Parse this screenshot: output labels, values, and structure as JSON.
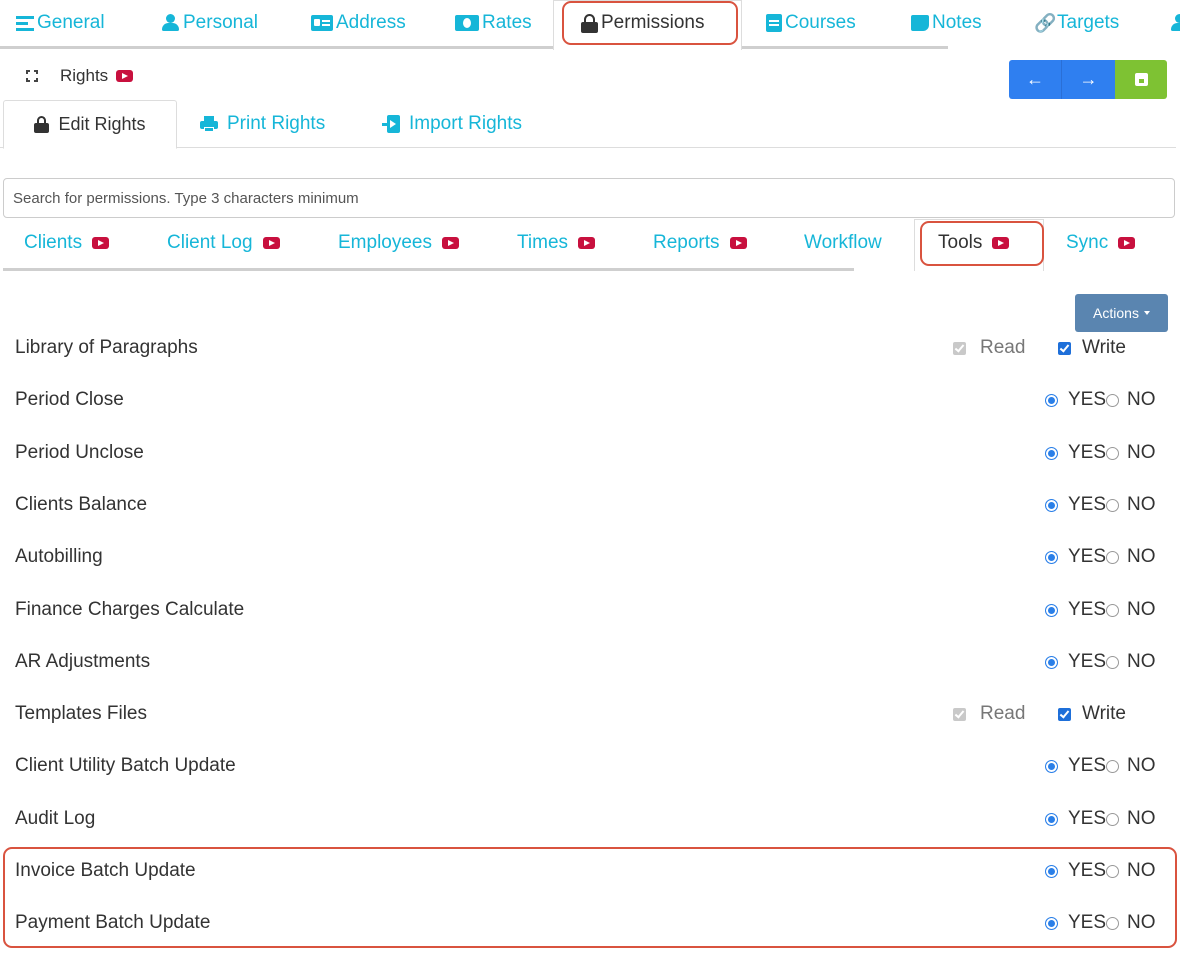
{
  "top_tabs": [
    {
      "label": "General",
      "icon": "lines-icon"
    },
    {
      "label": "Personal",
      "icon": "person-icon"
    },
    {
      "label": "Address",
      "icon": "address-card-icon"
    },
    {
      "label": "Rates",
      "icon": "money-icon"
    },
    {
      "label": "Permissions",
      "icon": "lock-icon",
      "active": true
    },
    {
      "label": "Courses",
      "icon": "book-icon"
    },
    {
      "label": "Notes",
      "icon": "note-icon"
    },
    {
      "label": "Targets",
      "icon": "link-icon"
    }
  ],
  "rights": {
    "title": "Rights",
    "tabs": [
      {
        "label": "Edit Rights",
        "icon": "lock-icon",
        "active": true
      },
      {
        "label": "Print Rights",
        "icon": "print-icon"
      },
      {
        "label": "Import Rights",
        "icon": "import-icon"
      }
    ]
  },
  "toolbar": {
    "back_symbol": "←",
    "forward_symbol": "→"
  },
  "search": {
    "placeholder": "Search for permissions. Type 3 characters minimum",
    "value": ""
  },
  "categories": [
    {
      "label": "Clients",
      "video": true
    },
    {
      "label": "Client Log",
      "video": true
    },
    {
      "label": "Employees",
      "video": true
    },
    {
      "label": "Times",
      "video": true
    },
    {
      "label": "Reports",
      "video": true
    },
    {
      "label": "Workflow",
      "video": false
    },
    {
      "label": "Tools",
      "video": true,
      "active": true
    },
    {
      "label": "Sync",
      "video": true
    }
  ],
  "actions": {
    "label": "Actions"
  },
  "options": {
    "read": "Read",
    "write": "Write",
    "yes": "YES",
    "no": "NO"
  },
  "permissions": [
    {
      "label": "Library of Paragraphs",
      "type": "read-write",
      "read": true,
      "write": true
    },
    {
      "label": "Period Close",
      "type": "yes-no",
      "value": "yes"
    },
    {
      "label": "Period Unclose",
      "type": "yes-no",
      "value": "yes"
    },
    {
      "label": "Clients Balance",
      "type": "yes-no",
      "value": "yes"
    },
    {
      "label": "Autobilling",
      "type": "yes-no",
      "value": "yes"
    },
    {
      "label": "Finance Charges Calculate",
      "type": "yes-no",
      "value": "yes"
    },
    {
      "label": "AR Adjustments",
      "type": "yes-no",
      "value": "yes"
    },
    {
      "label": "Templates Files",
      "type": "read-write",
      "read": true,
      "write": true
    },
    {
      "label": "Client Utility Batch Update",
      "type": "yes-no",
      "value": "yes"
    },
    {
      "label": "Audit Log",
      "type": "yes-no",
      "value": "yes"
    },
    {
      "label": "Invoice Batch Update",
      "type": "yes-no",
      "value": "yes"
    },
    {
      "label": "Payment Batch Update",
      "type": "yes-no",
      "value": "yes"
    }
  ],
  "colors": {
    "link": "#16b6d8",
    "highlight": "#d9533f",
    "video": "#c8103e",
    "nav_button": "#2f7ff0",
    "save_button": "#7ec233",
    "actions_button": "#5a85b0",
    "selected": "#2a7fe8"
  }
}
